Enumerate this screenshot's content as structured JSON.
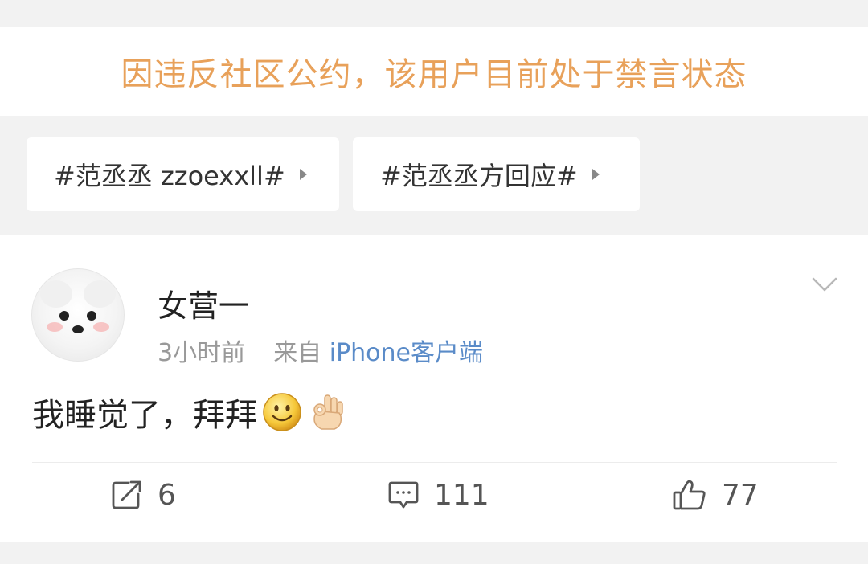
{
  "notice": {
    "text": "因违反社区公约，该用户目前处于禁言状态",
    "color": "#e8a15a"
  },
  "topics": [
    {
      "label": "#范丞丞 zzoexxll#",
      "icon": "triangle-right-icon"
    },
    {
      "label": "#范丞丞方回应#",
      "icon": "triangle-right-icon"
    }
  ],
  "post": {
    "username": "女营一",
    "time": "3小时前",
    "from_prefix": "来自",
    "source": "iPhone客户端",
    "source_color": "#5a8bc8",
    "text": "我睡觉了，拜拜",
    "emojis": [
      "smile-emoji-icon",
      "ok-hand-emoji-icon"
    ],
    "avatar_icon": "white-dog-avatar"
  },
  "actions": {
    "repost_count": "6",
    "comment_count": "111",
    "like_count": "77"
  }
}
